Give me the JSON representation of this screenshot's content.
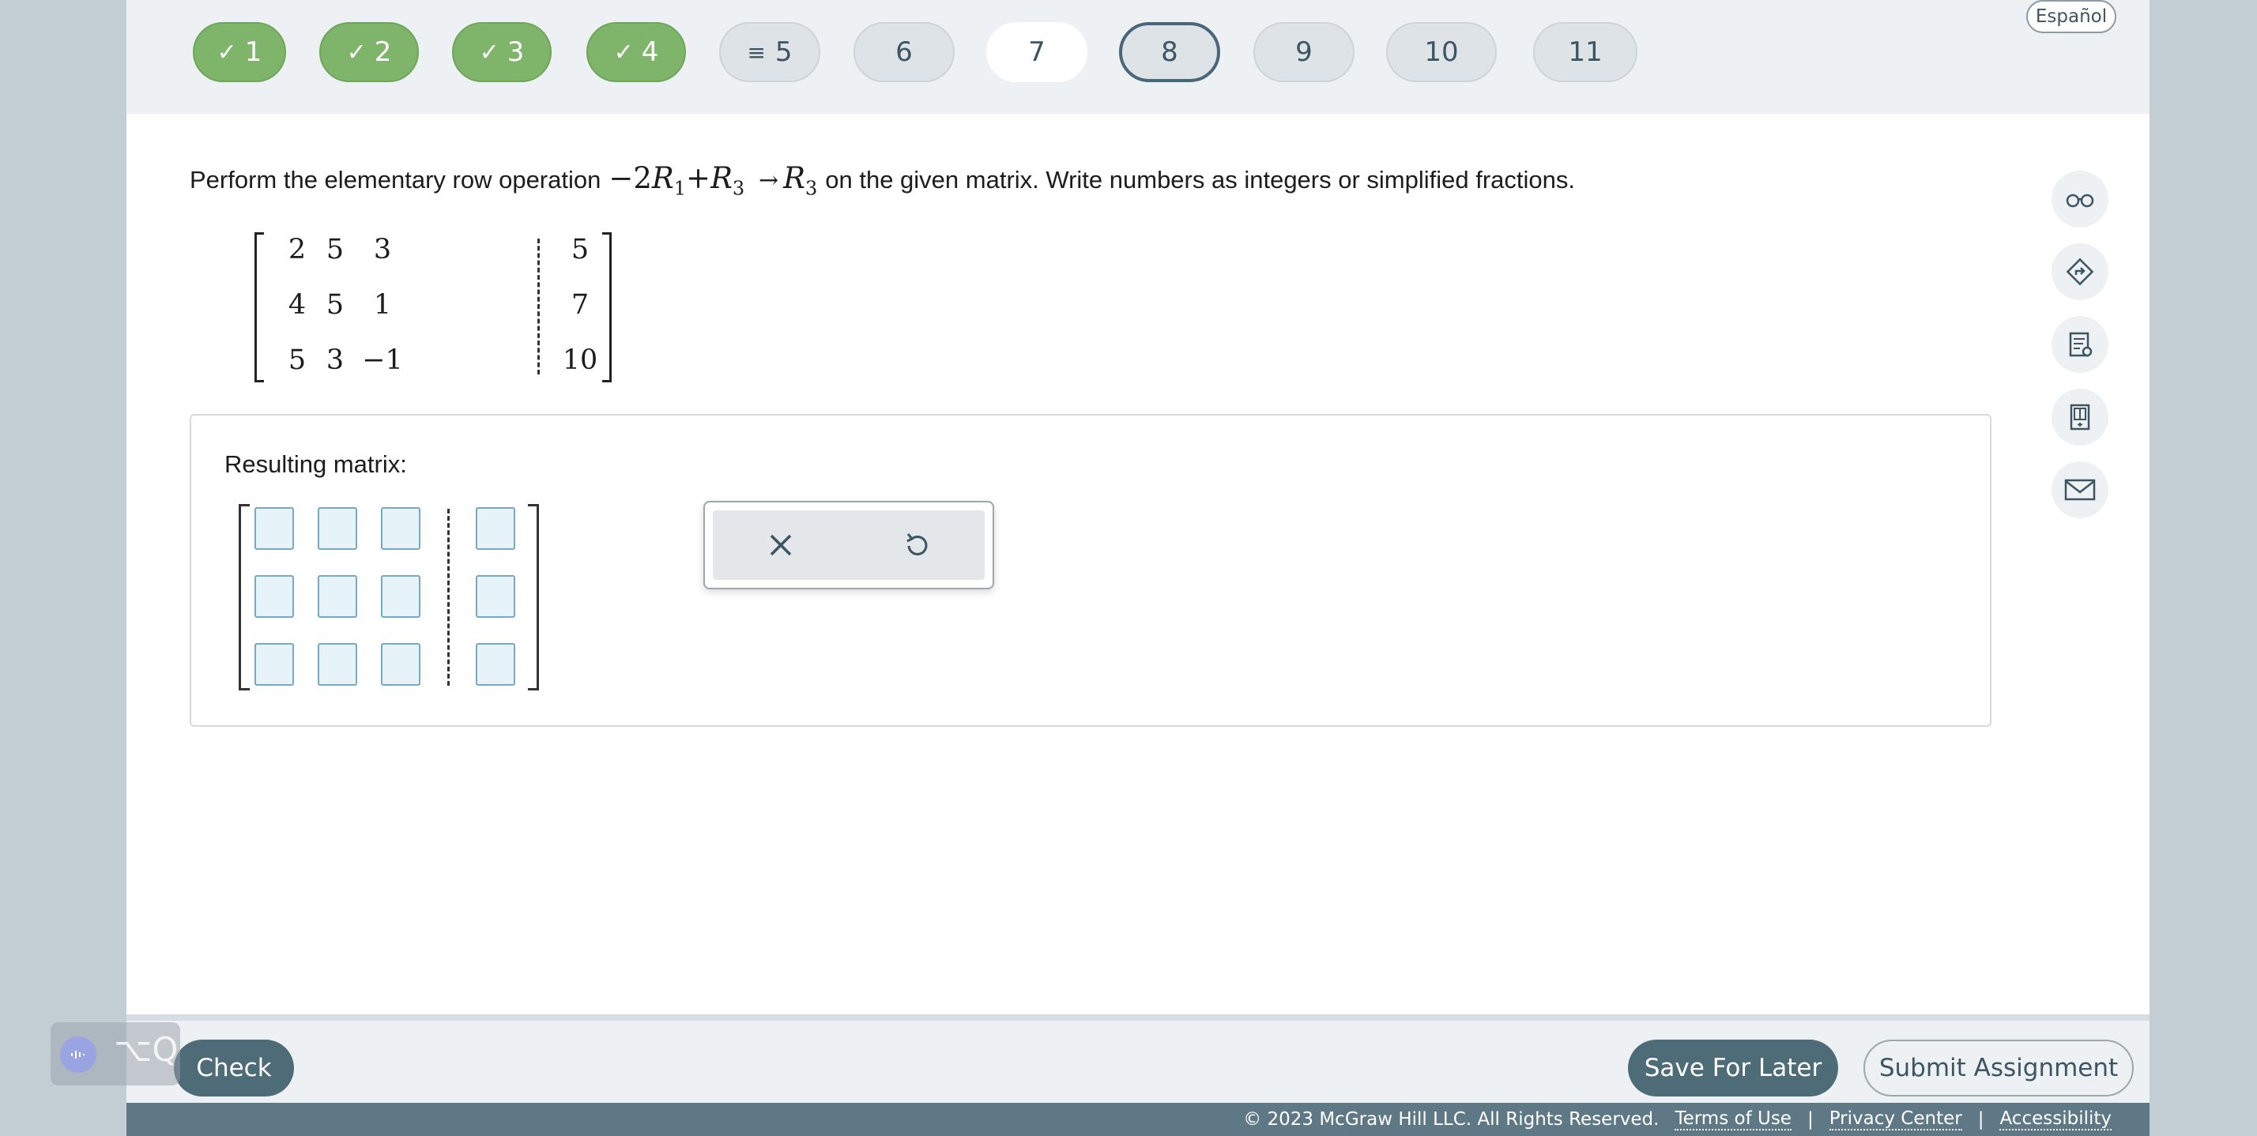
{
  "language_toggle": "Español",
  "questions": [
    {
      "label": "1",
      "state": "done"
    },
    {
      "label": "2",
      "state": "done"
    },
    {
      "label": "3",
      "state": "done"
    },
    {
      "label": "4",
      "state": "done"
    },
    {
      "label": "5",
      "state": "unfinished"
    },
    {
      "label": "6",
      "state": "default"
    },
    {
      "label": "7",
      "state": "current"
    },
    {
      "label": "8",
      "state": "selected"
    },
    {
      "label": "9",
      "state": "default"
    },
    {
      "label": "10",
      "state": "default"
    },
    {
      "label": "11",
      "state": "default"
    }
  ],
  "prompt": {
    "before": "Perform the elementary row operation",
    "operation": {
      "coef": "−2",
      "r1": "R",
      "s1": "1",
      "plus": "+",
      "r3": "R",
      "s3": "3",
      "arrow": "→",
      "r3b": "R",
      "s3b": "3"
    },
    "after": "on the given matrix. Write numbers as integers or simplified fractions."
  },
  "given_matrix": [
    [
      "2",
      "5",
      "3",
      "5"
    ],
    [
      "4",
      "5",
      "1",
      "7"
    ],
    [
      "5",
      "3",
      "−1",
      "10"
    ]
  ],
  "answer": {
    "label": "Resulting matrix:",
    "rows": 3,
    "cols": 4
  },
  "tools": {
    "clear": "×",
    "undo": "↺"
  },
  "side_tools": [
    "glasses-icon",
    "directions-icon",
    "notes-icon",
    "ebook-icon",
    "mail-icon"
  ],
  "buttons": {
    "check": "Check",
    "save": "Save For Later",
    "submit": "Submit Assignment"
  },
  "footer": {
    "copyright": "© 2023 McGraw Hill LLC. All Rights Reserved.",
    "terms": "Terms of Use",
    "privacy": "Privacy Center",
    "accessibility": "Accessibility",
    "sep": "|"
  },
  "overlay_keys": "⌥Q",
  "colors": {
    "done": "#7fb56a",
    "accent": "#4e6b78",
    "input": "#e6f3f8"
  }
}
